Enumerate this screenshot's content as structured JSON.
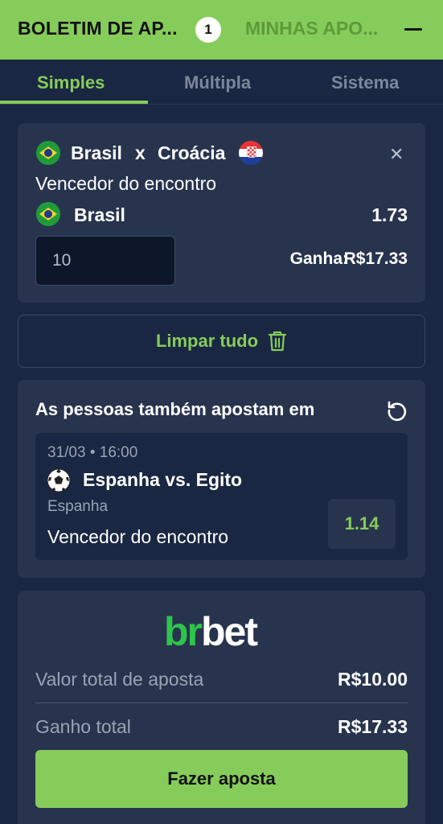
{
  "header": {
    "betslip_tab": "BOLETIM DE AP...",
    "betslip_count": "1",
    "my_bets_tab": "MINHAS APO..."
  },
  "mode_tabs": [
    {
      "label": "Simples",
      "active": true
    },
    {
      "label": "Múltipla",
      "active": false
    },
    {
      "label": "Sistema",
      "active": false
    }
  ],
  "bet": {
    "home_team": "Brasil",
    "vs": "x",
    "away_team": "Croácia",
    "market": "Vencedor do encontro",
    "selection": "Brasil",
    "odds": "1.73",
    "stake": "10",
    "win_label": "Ganha:",
    "win_value": "R$17.33",
    "home_flag_icon": "brazil-flag-icon",
    "away_flag_icon": "croatia-flag-icon"
  },
  "clear_all": {
    "label": "Limpar tudo",
    "icon": "trash-icon"
  },
  "suggestions": {
    "title": "As pessoas também apostam em",
    "refresh_icon": "refresh-icon",
    "item": {
      "datetime": "31/03 • 16:00",
      "sport_icon": "soccer-ball-icon",
      "event": "Espanha vs. Egito",
      "selection": "Espanha",
      "market": "Vencedor do encontro",
      "odds": "1.14"
    }
  },
  "summary": {
    "brand_green": "br",
    "brand_white": "bet",
    "total_stake_label": "Valor total de aposta",
    "total_stake_value": "R$10.00",
    "total_win_label": "Ganho total",
    "total_win_value": "R$17.33",
    "place_bet_label": "Fazer aposta"
  },
  "colors": {
    "accent": "#86cc5a",
    "background": "#1a2742",
    "card": "#28344e"
  }
}
